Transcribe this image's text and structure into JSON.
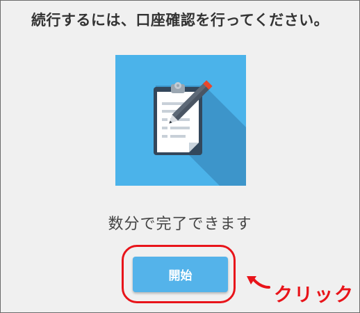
{
  "heading": "続行するには、口座確認を行ってください。",
  "illustration": {
    "icon": "clipboard-with-pen-icon",
    "background_color": "#4bb3ea"
  },
  "subtext": "数分で完了できます",
  "start_button": {
    "label": "開始",
    "color": "#54b3ea"
  },
  "annotation": {
    "label": "クリック",
    "color": "#e8141a",
    "icon": "arrow-left-icon"
  }
}
